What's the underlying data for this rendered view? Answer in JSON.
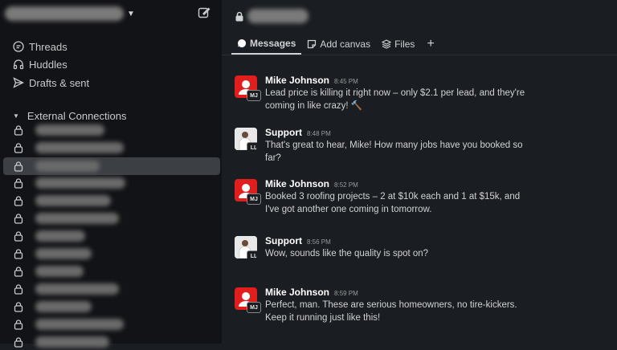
{
  "sidebar": {
    "nav": [
      {
        "label": "Threads",
        "icon": "threads-icon"
      },
      {
        "label": "Huddles",
        "icon": "headphones-icon"
      },
      {
        "label": "Drafts & sent",
        "icon": "send-icon"
      }
    ],
    "section_title": "External Connections",
    "channel_count": 13,
    "active_channel_index": 2
  },
  "tabs": [
    {
      "label": "Messages",
      "icon": "message-icon",
      "active": true
    },
    {
      "label": "Add canvas",
      "icon": "canvas-icon",
      "active": false
    },
    {
      "label": "Files",
      "icon": "files-icon",
      "active": false
    }
  ],
  "messages": [
    {
      "name": "Mike Johnson",
      "time": "8:45 PM",
      "initials": "MJ",
      "text": "Lead price is killing it right now – only $2.1 per lead, and they're coming in like crazy! 🔨"
    },
    {
      "name": "Support",
      "time": "8:48 PM",
      "initials": "LL",
      "text": "That's great to hear, Mike! How many jobs have you booked so far?"
    },
    {
      "name": "Mike Johnson",
      "time": "8:52 PM",
      "initials": "MJ",
      "text": "Booked 3 roofing projects – 2 at $10k each and 1 at $15k, and I've got another one coming in tomorrow."
    },
    {
      "name": "Support",
      "time": "8:56 PM",
      "initials": "LL",
      "text": "Wow, sounds like the quality is spot on?"
    },
    {
      "name": "Mike Johnson",
      "time": "8:59 PM",
      "initials": "MJ",
      "text": "Perfect, man. These are serious homeowners, no tire-kickers. Keep it running just like this!"
    }
  ],
  "colors": {
    "sidebar_bg": "#121316",
    "main_bg": "#1a1d21",
    "avatar_red": "#e01e1e",
    "active_row": "#3c3f44"
  }
}
